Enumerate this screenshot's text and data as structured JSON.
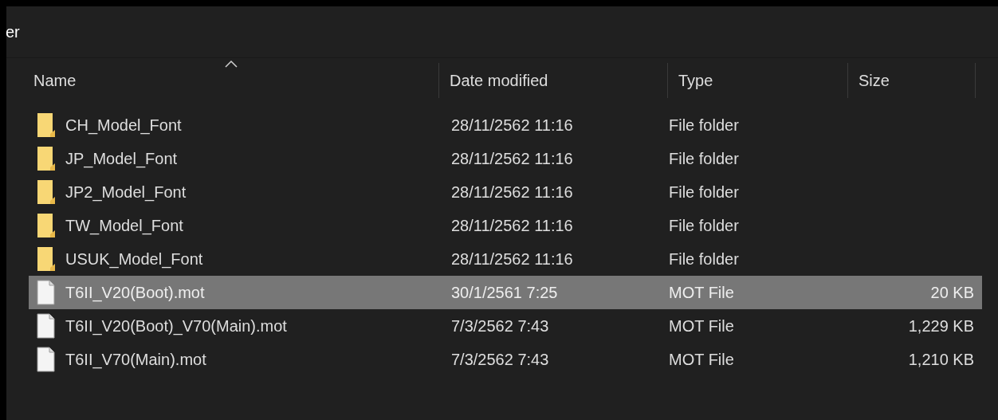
{
  "window": {
    "title_fragment": "er"
  },
  "table": {
    "columns": [
      {
        "label": "Name",
        "sorted": true
      },
      {
        "label": "Date modified",
        "sorted": false
      },
      {
        "label": "Type",
        "sorted": false
      },
      {
        "label": "Size",
        "sorted": false
      }
    ],
    "rows": [
      {
        "kind": "folder",
        "name": "CH_Model_Font",
        "date": "28/11/2562 11:16",
        "type": "File folder",
        "selected": false
      },
      {
        "kind": "folder",
        "name": "JP_Model_Font",
        "date": "28/11/2562 11:16",
        "type": "File folder",
        "selected": false
      },
      {
        "kind": "folder",
        "name": "JP2_Model_Font",
        "date": "28/11/2562 11:16",
        "type": "File folder",
        "selected": false
      },
      {
        "kind": "folder",
        "name": "TW_Model_Font",
        "date": "28/11/2562 11:16",
        "type": "File folder",
        "selected": false
      },
      {
        "kind": "folder",
        "name": "USUK_Model_Font",
        "date": "28/11/2562 11:16",
        "type": "File folder",
        "selected": false
      },
      {
        "kind": "file",
        "name": "T6II_V20(Boot).mot",
        "date": "30/1/2561 7:25",
        "type": "MOT File",
        "size": "20 KB",
        "selected": true
      },
      {
        "kind": "file",
        "name": "T6II_V20(Boot)_V70(Main).mot",
        "date": "7/3/2562 7:43",
        "type": "MOT File",
        "size": "1,229 KB",
        "selected": false
      },
      {
        "kind": "file",
        "name": "T6II_V70(Main).mot",
        "date": "7/3/2562 7:43",
        "type": "MOT File",
        "size": "1,210 KB",
        "selected": false
      }
    ]
  }
}
